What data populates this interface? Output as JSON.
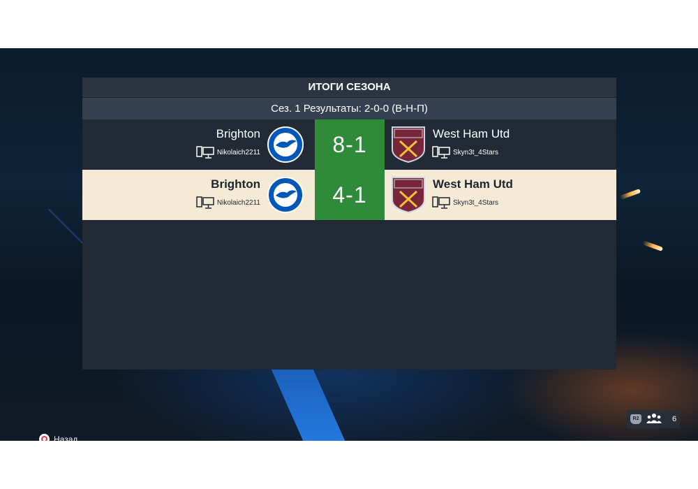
{
  "header": {
    "title": "ИТОГИ СЕЗОНА",
    "subtitle": "Сез. 1 Результаты: 2-0-0 (В-Н-П)"
  },
  "matches": [
    {
      "home_team": "Brighton",
      "home_player": "Nikolaich2211",
      "score": "8-1",
      "away_team": "West Ham Utd",
      "away_player": "Skyn3t_4Stars",
      "home_crest_text": "BRIGHTON & HOVE ALBION",
      "away_crest_text": "WEST HAM UNITED LONDON"
    },
    {
      "home_team": "Brighton",
      "home_player": "Nikolaich2211",
      "score": "4-1",
      "away_team": "West Ham Utd",
      "away_player": "Skyn3t_4Stars",
      "home_crest_text": "BRIGHTON & HOVE ALBION",
      "away_crest_text": "WEST HAM UNITED LONDON"
    }
  ],
  "footer": {
    "back_label": "Назад",
    "r2_label": "R2",
    "online_count": "6"
  },
  "icons": {
    "back": "circle-button-icon",
    "platform": "pc-icon",
    "r2": "r2-button-icon",
    "online": "people-icon"
  },
  "colors": {
    "score_bg": "#2f8a3a",
    "highlight_row": "#f4ead6",
    "panel_bg": "#222a35",
    "brighton_blue": "#0057b8",
    "westham_claret": "#7a263a"
  }
}
